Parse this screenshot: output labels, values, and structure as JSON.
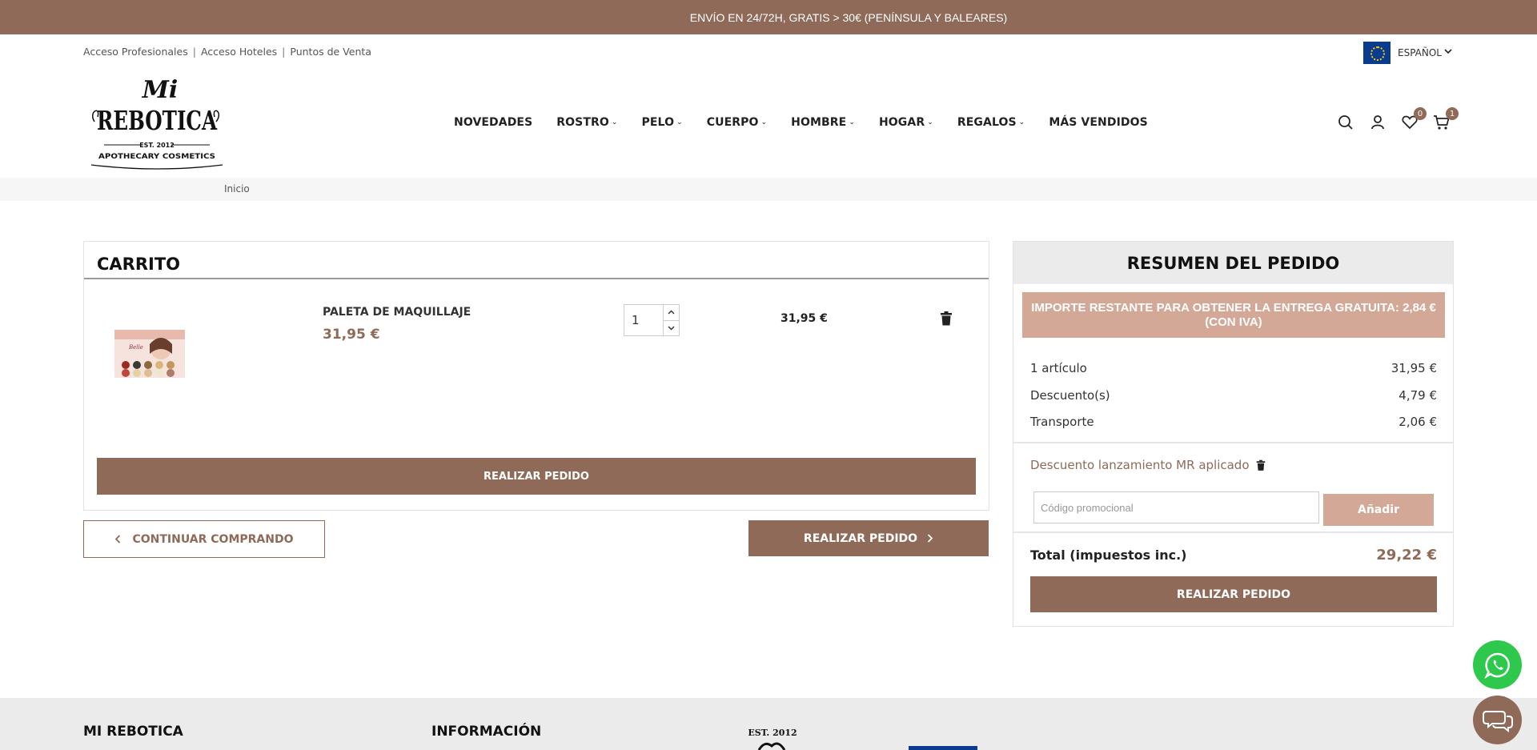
{
  "announcement": "ENVÍO EN 24/72H, GRATIS > 30€ (PENÍNSULA Y BALEARES)",
  "pro_links": [
    "Acceso Profesionales",
    "Acceso Hoteles",
    "Puntos de Venta"
  ],
  "language": "ESPAÑOL",
  "logo": {
    "line1": "Mi",
    "line2": "REBOTICA",
    "est": "EST. 2012",
    "tagline": "APOTHECARY COSMETICS"
  },
  "nav": [
    "NOVEDADES",
    "ROSTRO",
    "PELO",
    "CUERPO",
    "HOMBRE",
    "HOGAR",
    "REGALOS",
    "MÁS VENDIDOS"
  ],
  "header_icons": {
    "wishlist_count": "0",
    "cart_count": "1"
  },
  "breadcrumb": "Inicio",
  "cart": {
    "title": "CARRITO",
    "item": {
      "name": "PALETA DE MAQUILLAJE",
      "price": "31,95 €",
      "quantity": "1",
      "line_total": "31,95 €"
    },
    "order_button": "REALIZAR PEDIDO",
    "continue_button": "CONTINUAR COMPRANDO",
    "order_button_2": "REALIZAR PEDIDO"
  },
  "summary": {
    "title": "RESUMEN DEL PEDIDO",
    "free_shipping_notice": "IMPORTE RESTANTE PARA OBTENER LA ENTREGA GRATUITA: 2,84 € (CON IVA)",
    "rows": [
      {
        "label": "1 artículo",
        "value": "31,95 €"
      },
      {
        "label": "Descuento(s)",
        "value": "4,79 €"
      },
      {
        "label": "Transporte",
        "value": "2,06 €"
      }
    ],
    "voucher": "Descuento lanzamiento MR aplicado",
    "promo_placeholder": "Código promocional",
    "promo_button": "Añadir",
    "total_label": "Total (impuestos inc.)",
    "total_value": "29,22 €",
    "order_button": "REALIZAR PEDIDO"
  },
  "footer": {
    "col1": "MI REBOTICA",
    "col2": "INFORMACIÓN",
    "est": "EST. 2012"
  },
  "colors": {
    "brand": "#8f6a58",
    "light_brand": "#d4a896",
    "whatsapp": "#2ec84d"
  }
}
